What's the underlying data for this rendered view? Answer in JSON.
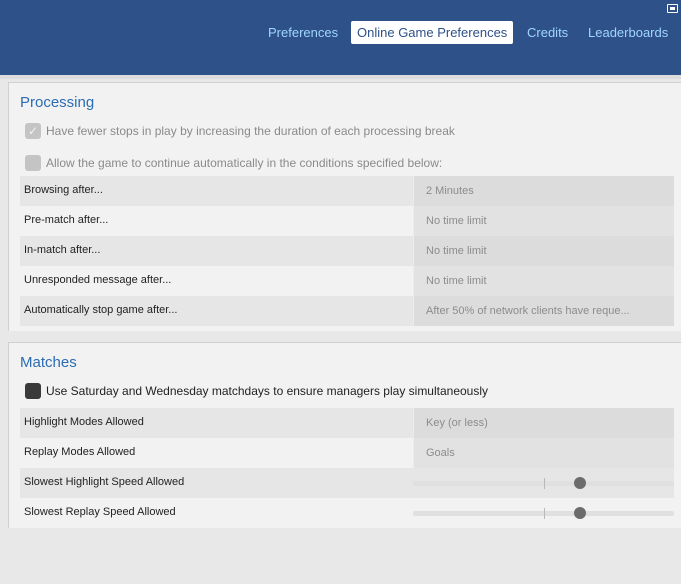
{
  "header": {
    "tabs": [
      {
        "label": "Preferences",
        "active": false
      },
      {
        "label": "Online Game Preferences",
        "active": true
      },
      {
        "label": "Credits",
        "active": false
      },
      {
        "label": "Leaderboards",
        "active": false
      }
    ],
    "corner_icon": "keyboard-icon"
  },
  "processing": {
    "title": "Processing",
    "fewer_stops": {
      "label": "Have fewer stops in play by increasing the duration of each processing break",
      "checked": true
    },
    "auto_continue": {
      "label": "Allow the game to continue automatically in the conditions specified below:",
      "checked": false
    },
    "rows": [
      {
        "label": "Browsing after...",
        "value": "2 Minutes"
      },
      {
        "label": "Pre-match after...",
        "value": "No time limit"
      },
      {
        "label": "In-match after...",
        "value": "No time limit"
      },
      {
        "label": "Unresponded message after...",
        "value": "No time limit"
      },
      {
        "label": "Automatically stop game after...",
        "value": "After 50% of network clients have reque..."
      }
    ]
  },
  "matches": {
    "title": "Matches",
    "simultaneous": {
      "label": "Use Saturday and Wednesday matchdays to ensure managers play simultaneously",
      "checked": false
    },
    "rows": [
      {
        "label": "Highlight Modes Allowed",
        "value": "Key (or less)"
      },
      {
        "label": "Replay Modes Allowed",
        "value": "Goals"
      }
    ],
    "sliders": [
      {
        "label": "Slowest Highlight Speed Allowed",
        "level": 0.64
      },
      {
        "label": "Slowest Replay Speed Allowed",
        "level": 0.64
      }
    ]
  },
  "colors": {
    "header_bg": "#2f5189",
    "tab_text": "#9fd6ff",
    "section_title": "#2b6cb3"
  }
}
